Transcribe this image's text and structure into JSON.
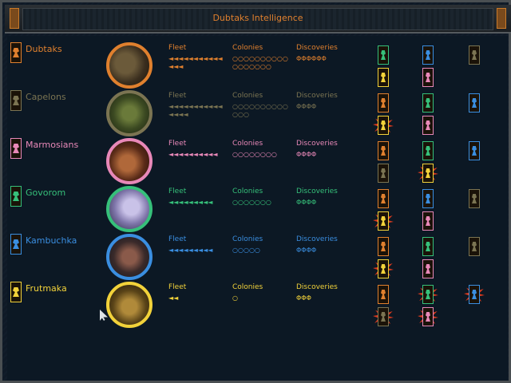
{
  "title": "Dubtaks Intelligence",
  "colors": {
    "orange": "#e0802e",
    "olive": "#7b7452",
    "pink": "#e888b8",
    "green": "#36c07a",
    "blue": "#3a8ee0",
    "yellow": "#f2d23a"
  },
  "headers": {
    "fleet": "Fleet",
    "colonies": "Colonies",
    "discoveries": "Discoveries"
  },
  "races": [
    {
      "name": "Dubtaks",
      "fleet": "◄◄◄◄◄◄◄◄◄◄◄◄◄◄",
      "colonies": "○○○○○○○○○○○○○○○○○",
      "discoveries": "ΦΦΦΦΦΦ",
      "portrait": "dubtak-portrait"
    },
    {
      "name": "Capelons",
      "fleet": "◄◄◄◄◄◄◄◄◄◄◄◄◄◄◄",
      "colonies": "○○○○○○○○○○○○○",
      "discoveries": "ΦΦΦΦ",
      "portrait": "capelon-portrait"
    },
    {
      "name": "Marmosians",
      "fleet": "◄◄◄◄◄◄◄◄◄◄",
      "colonies": "○○○○○○○○",
      "discoveries": "ΦΦΦΦ",
      "portrait": "marmosian-portrait"
    },
    {
      "name": "Govorom",
      "fleet": "◄◄◄◄◄◄◄◄◄",
      "colonies": "○○○○○○○",
      "discoveries": "ΦΦΦΦ",
      "portrait": "govorom-portrait"
    },
    {
      "name": "Kambuchka",
      "fleet": "◄◄◄◄◄◄◄◄◄",
      "colonies": "○○○○○",
      "discoveries": "ΦΦΦΦ",
      "portrait": "kambuchka-portrait"
    },
    {
      "name": "Frutmaka",
      "fleet": "◄◄",
      "colonies": "○",
      "discoveries": "ΦΦΦ",
      "portrait": "frutmaka-portrait"
    }
  ],
  "relations_note_icons": [
    "race-emblem-icon",
    "war-burst-icon",
    "cursor-icon"
  ]
}
